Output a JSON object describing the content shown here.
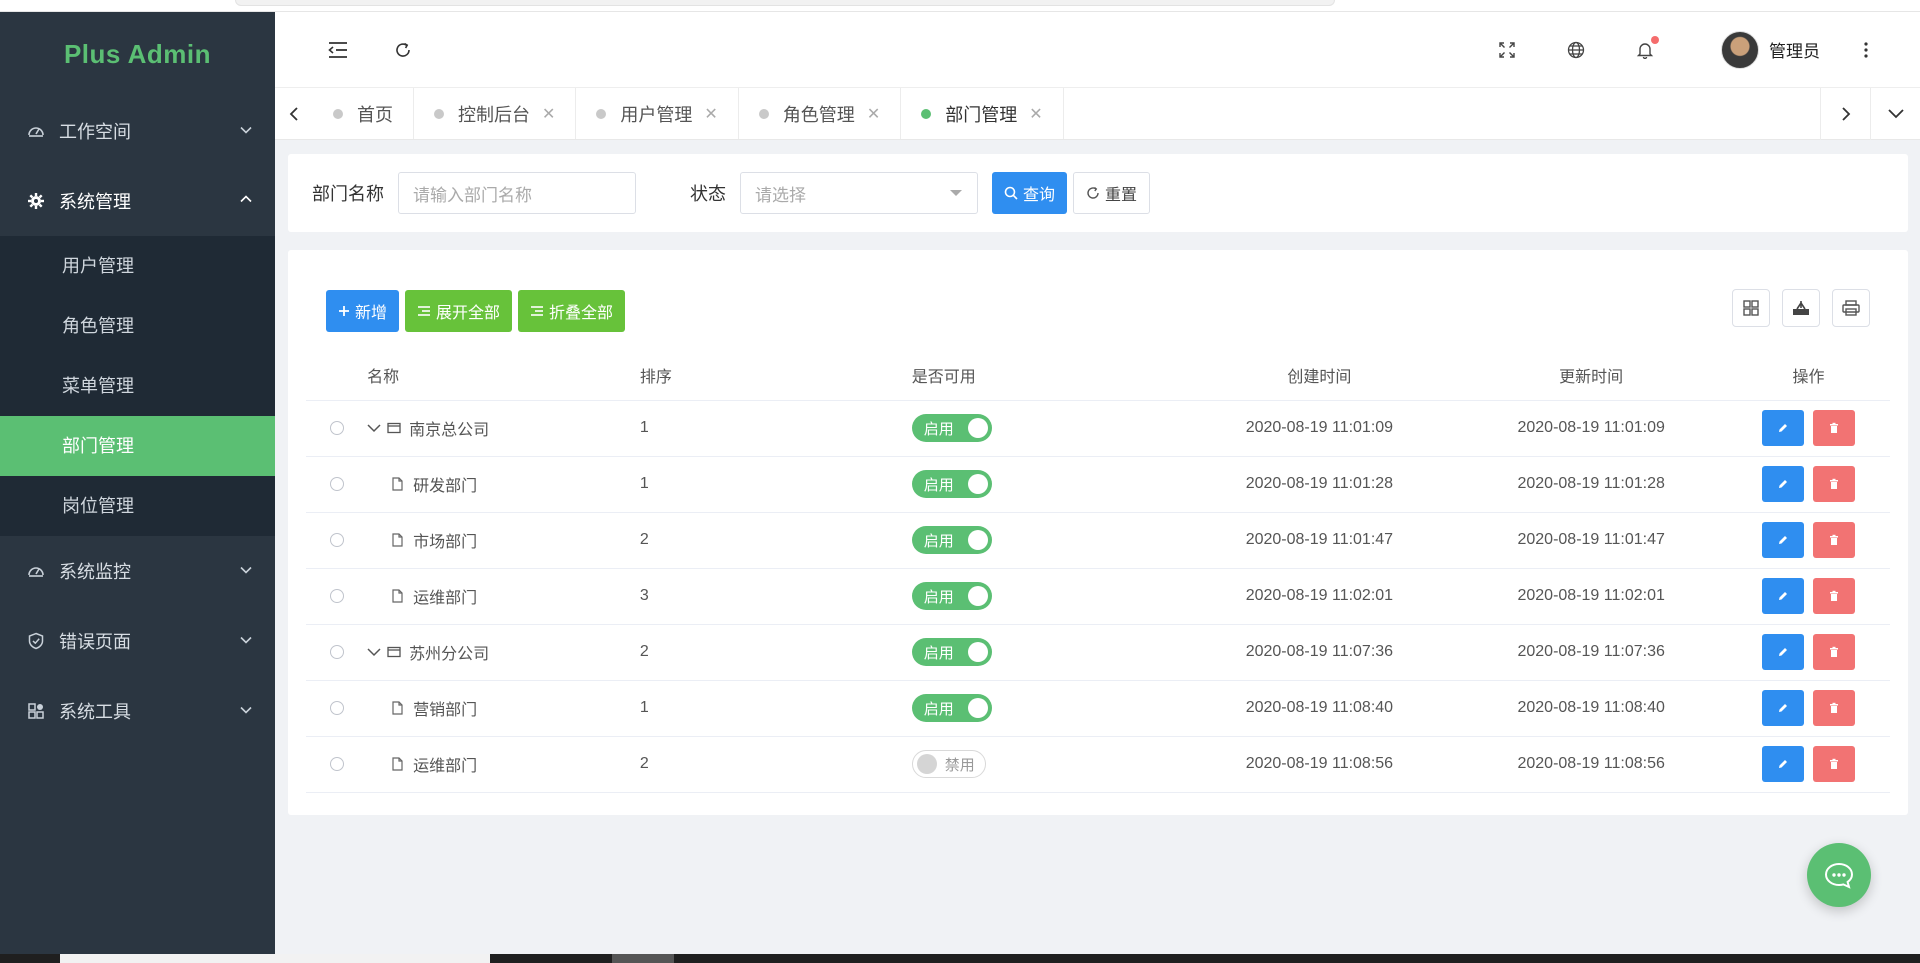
{
  "app": {
    "logo": "Plus Admin"
  },
  "sidebar": {
    "groups": [
      {
        "label": "工作空间",
        "icon": "dashboard-icon",
        "open": false
      },
      {
        "label": "系统管理",
        "icon": "gear-icon",
        "open": true,
        "children": [
          {
            "label": "用户管理",
            "active": false
          },
          {
            "label": "角色管理",
            "active": false
          },
          {
            "label": "菜单管理",
            "active": false
          },
          {
            "label": "部门管理",
            "active": true
          },
          {
            "label": "岗位管理",
            "active": false
          }
        ]
      },
      {
        "label": "系统监控",
        "icon": "monitor-icon",
        "open": false
      },
      {
        "label": "错误页面",
        "icon": "shield-icon",
        "open": false
      },
      {
        "label": "系统工具",
        "icon": "tools-icon",
        "open": false
      }
    ]
  },
  "header": {
    "username": "管理员"
  },
  "tabs": [
    {
      "label": "首页",
      "active": false,
      "closable": false
    },
    {
      "label": "控制后台",
      "active": false,
      "closable": true
    },
    {
      "label": "用户管理",
      "active": false,
      "closable": true
    },
    {
      "label": "角色管理",
      "active": false,
      "closable": true
    },
    {
      "label": "部门管理",
      "active": true,
      "closable": true
    }
  ],
  "search": {
    "dept_label": "部门名称",
    "dept_placeholder": "请输入部门名称",
    "status_label": "状态",
    "status_placeholder": "请选择",
    "query_label": "查询",
    "reset_label": "重置"
  },
  "toolbar": {
    "add_label": "新增",
    "expand_label": "展开全部",
    "collapse_label": "折叠全部"
  },
  "table": {
    "headers": {
      "name": "名称",
      "sort": "排序",
      "status": "是否可用",
      "created": "创建时间",
      "updated": "更新时间",
      "ops": "操作"
    },
    "rows": [
      {
        "name": "南京总公司",
        "level": 0,
        "sort": "1",
        "status": "启用",
        "enabled": true,
        "created": "2020-08-19 11:01:09",
        "updated": "2020-08-19 11:01:09"
      },
      {
        "name": "研发部门",
        "level": 1,
        "sort": "1",
        "status": "启用",
        "enabled": true,
        "created": "2020-08-19 11:01:28",
        "updated": "2020-08-19 11:01:28"
      },
      {
        "name": "市场部门",
        "level": 1,
        "sort": "2",
        "status": "启用",
        "enabled": true,
        "created": "2020-08-19 11:01:47",
        "updated": "2020-08-19 11:01:47"
      },
      {
        "name": "运维部门",
        "level": 1,
        "sort": "3",
        "status": "启用",
        "enabled": true,
        "created": "2020-08-19 11:02:01",
        "updated": "2020-08-19 11:02:01"
      },
      {
        "name": "苏州分公司",
        "level": 0,
        "sort": "2",
        "status": "启用",
        "enabled": true,
        "created": "2020-08-19 11:07:36",
        "updated": "2020-08-19 11:07:36"
      },
      {
        "name": "营销部门",
        "level": 1,
        "sort": "1",
        "status": "启用",
        "enabled": true,
        "created": "2020-08-19 11:08:40",
        "updated": "2020-08-19 11:08:40"
      },
      {
        "name": "运维部门",
        "level": 1,
        "sort": "2",
        "status": "禁用",
        "enabled": false,
        "created": "2020-08-19 11:08:56",
        "updated": "2020-08-19 11:08:56"
      }
    ]
  },
  "colors": {
    "brand": "#5bbf73",
    "primary": "#2f8ef0",
    "danger": "#f27373",
    "success": "#67c23a",
    "sidebar_bg": "#2b3641"
  }
}
